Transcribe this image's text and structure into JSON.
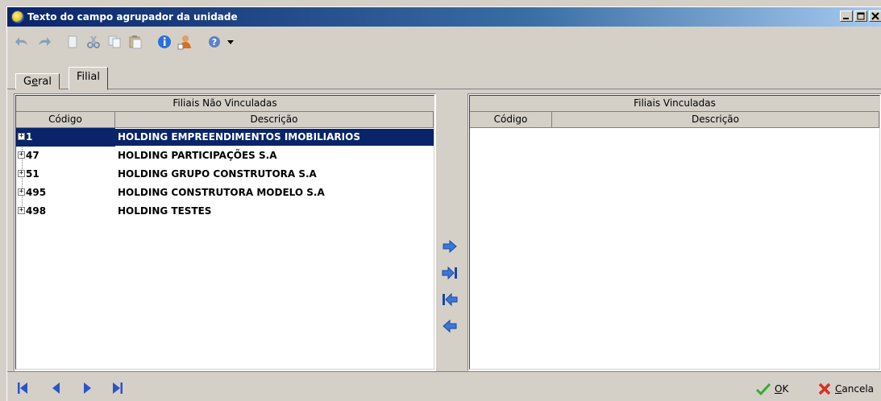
{
  "window": {
    "title": "Texto do campo agrupador da unidade"
  },
  "toolbar": {
    "icons": [
      "undo-icon",
      "redo-icon",
      "new-icon",
      "cut-icon",
      "copy-icon",
      "paste-icon",
      "info-icon",
      "user-icon",
      "help-icon",
      "dropdown-icon"
    ]
  },
  "tabs": [
    {
      "label_pre": "G",
      "label_ul": "e",
      "label_post": "ral"
    },
    {
      "label": "Filial"
    }
  ],
  "left_grid": {
    "group_header": "Filiais Não Vinculadas",
    "columns": [
      "Código",
      "Descrição"
    ],
    "rows": [
      {
        "code": "1",
        "desc": "HOLDING EMPREENDIMENTOS IMOBILIARIOS",
        "selected": true
      },
      {
        "code": "47",
        "desc": "HOLDING PARTICIPAÇÕES S.A"
      },
      {
        "code": "51",
        "desc": "HOLDING GRUPO CONSTRUTORA S.A"
      },
      {
        "code": "495",
        "desc": "HOLDING CONSTRUTORA MODELO S.A"
      },
      {
        "code": "498",
        "desc": "HOLDING TESTES"
      }
    ],
    "expander": "+"
  },
  "right_grid": {
    "group_header": "Filiais Vinculadas",
    "columns": [
      "Código",
      "Descrição"
    ]
  },
  "buttons": {
    "ok_ul": "O",
    "ok_rest": "K",
    "cancel_ul": "C",
    "cancel_rest": "ancela"
  },
  "colors": {
    "selection": "#0a246a",
    "arrow_blue": "#3a78d8",
    "nav_blue": "#2a55c8"
  }
}
